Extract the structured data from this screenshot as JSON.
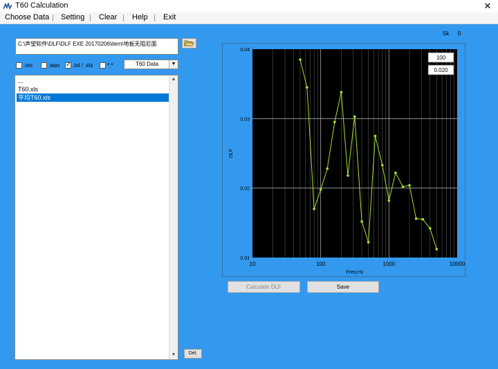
{
  "window": {
    "title": "T60 Calculation",
    "close_glyph": "✕"
  },
  "menu": [
    {
      "label": "Choose Data"
    },
    {
      "label": "Setting"
    },
    {
      "label": "Clear"
    },
    {
      "label": "Help"
    },
    {
      "label": "Exit"
    }
  ],
  "path": {
    "value": "C:\\声望软件\\DLF\\DLF EXE 20170206\\item\\地板无阻尼面"
  },
  "filters": [
    {
      "label": ".rec",
      "checked": false
    },
    {
      "label": ".wav",
      "checked": false
    },
    {
      "label": ".txt / .xls",
      "checked": true
    },
    {
      "label": "*.*",
      "checked": false
    }
  ],
  "data_select": {
    "value": "T60 Data"
  },
  "file_list": {
    "items": [
      "...",
      "T60.xls",
      "平均T60.xls"
    ],
    "selected_index": 2
  },
  "del_button": {
    "label": "Del."
  },
  "sk": {
    "label": "Sk",
    "value": "0"
  },
  "chart_inputs": {
    "top": "100",
    "bottom": "0.020"
  },
  "buttons": {
    "calculate": "Calculate DLF",
    "save": "Save"
  },
  "colors": {
    "background": "#3399ee",
    "plot": "#000000",
    "series": "#a6e22e",
    "accent": "#0078d7"
  },
  "chart_data": {
    "type": "line",
    "xlabel": "Freq,Hz",
    "ylabel": "DLF",
    "x_scale": "log",
    "xlim": [
      10,
      10000
    ],
    "ylim": [
      0.01,
      0.04
    ],
    "x_ticks": [
      "10",
      "100",
      "1000",
      "10000"
    ],
    "y_ticks": [
      "0.01",
      "0.02",
      "0.03",
      "0.04"
    ],
    "grid": true,
    "series": [
      {
        "x": [
          50,
          63,
          80,
          100,
          125,
          160,
          200,
          250,
          315,
          400,
          500,
          630,
          800,
          1000,
          1250,
          1600,
          2000,
          2500,
          3150,
          4000,
          5000
        ],
        "values": [
          0.0385,
          0.0345,
          0.017,
          0.0198,
          0.0228,
          0.0295,
          0.0338,
          0.0218,
          0.0303,
          0.0152,
          0.0122,
          0.0275,
          0.0233,
          0.0182,
          0.0222,
          0.0202,
          0.0204,
          0.0156,
          0.0155,
          0.0142,
          0.0112
        ]
      }
    ]
  }
}
